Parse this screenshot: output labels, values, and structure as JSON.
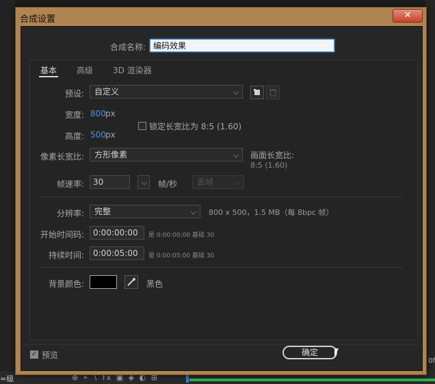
{
  "dialog": {
    "title": "合成设置",
    "close_label": "✕"
  },
  "comp_name": {
    "label": "合成名称:",
    "value": "编码效果"
  },
  "tabs": [
    {
      "label": "基本",
      "active": true
    },
    {
      "label": "高级",
      "active": false
    },
    {
      "label": "3D 渲染器",
      "active": false
    }
  ],
  "preset": {
    "label": "预设:",
    "value": "自定义"
  },
  "width": {
    "label": "宽度:",
    "value": "800",
    "unit": "px"
  },
  "height": {
    "label": "高度:",
    "value": "500",
    "unit": "px"
  },
  "lock_ratio": {
    "label": "锁定长宽比为 8:5 (1.60)",
    "checked": false
  },
  "pixel_aspect": {
    "label": "像素长宽比:",
    "value": "方形像素"
  },
  "frame_aspect": {
    "label": "画面长宽比:",
    "value": "8:5 (1.60)"
  },
  "frame_rate": {
    "label": "帧速率:",
    "value": "30",
    "unit": "帧/秒",
    "drop_frame": "丢帧"
  },
  "resolution": {
    "label": "分辨率:",
    "value": "完整",
    "info": "800 x 500，1.5 MB（每 8bpc 帧）"
  },
  "start_timecode": {
    "label": "开始时间码:",
    "value": "0:00:00:00",
    "note": "是 0:00:00:00  基础 30"
  },
  "duration": {
    "label": "持续时间:",
    "value": "0:00:05:00",
    "note": "是 0:00:05:00  基础 30"
  },
  "background": {
    "label": "背景颜色:",
    "color": "#000000",
    "color_name": "黑色"
  },
  "preview": {
    "label": "预览",
    "checked": true
  },
  "ok_label": "确定",
  "background_app": {
    "left_text": "≈级",
    "tools": "⊕ ⌖ ∖ fx ▣ ◈ ◐ ⊞",
    "right_text": "0f"
  },
  "colors": {
    "accent": "#4a90e2",
    "titlebar": "#b08450",
    "panel": "#262626"
  }
}
